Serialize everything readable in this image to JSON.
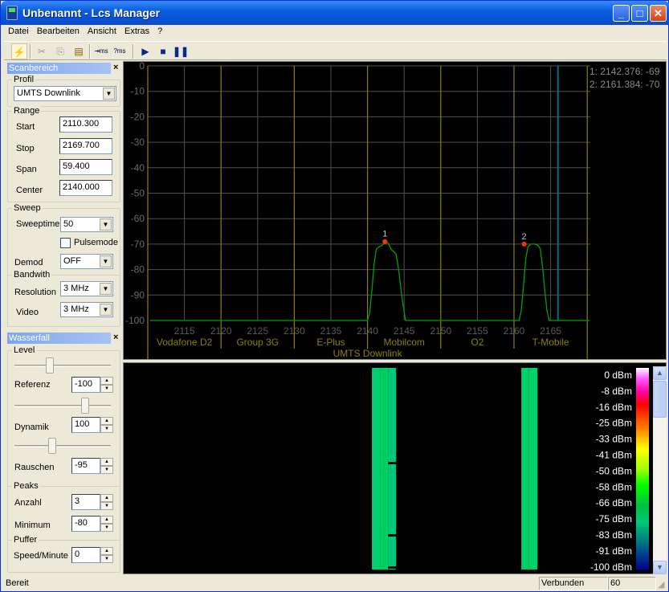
{
  "window": {
    "title": "Unbenannt - Lcs Manager",
    "buttons": [
      "minimize",
      "maximize",
      "close"
    ]
  },
  "menu": [
    "Datei",
    "Bearbeiten",
    "Ansicht",
    "Extras",
    "?"
  ],
  "toolbar": {
    "buttons": [
      {
        "name": "connect-button",
        "icon": "lightning-icon",
        "glyph": "⚡"
      },
      {
        "name": "cut-button",
        "icon": "scissors-icon",
        "glyph": "✂"
      },
      {
        "name": "copy-button",
        "icon": "copy-icon",
        "glyph": "⎘"
      },
      {
        "name": "paste-button",
        "icon": "clipboard-icon",
        "glyph": "📋"
      },
      {
        "name": "sweep-time-button",
        "icon": "sweep-time-icon",
        "glyph": "ms"
      },
      {
        "name": "sweep-time-auto-button",
        "icon": "sweep-time-question-icon",
        "glyph": "?ms"
      },
      {
        "name": "play-button",
        "icon": "play-icon",
        "glyph": "▶"
      },
      {
        "name": "stop-button",
        "icon": "stop-icon",
        "glyph": "■"
      },
      {
        "name": "pause-button",
        "icon": "pause-icon",
        "glyph": "❚❚"
      }
    ]
  },
  "scanbereich": {
    "title": "Scanbereich",
    "close": "×",
    "profil_label": "Profil",
    "profil_value": "UMTS Downlink",
    "range_label": "Range",
    "start_label": "Start",
    "start_value": "2110.300",
    "stop_label": "Stop",
    "stop_value": "2169.700",
    "span_label": "Span",
    "span_value": "59.400",
    "center_label": "Center",
    "center_value": "2140.000",
    "sweep_label": "Sweep",
    "sweeptime_label": "Sweeptime",
    "sweeptime_value": "50",
    "pulsemode_label": "Pulsemode",
    "pulsemode_checked": false,
    "demod_label": "Demod",
    "demod_value": "OFF",
    "bandwith_label": "Bandwith",
    "resolution_label": "Resolution",
    "resolution_value": "3 MHz",
    "video_label": "Video",
    "video_value": "3 MHz"
  },
  "wasserfall": {
    "title": "Wasserfall",
    "close": "×",
    "level_label": "Level",
    "referenz_label": "Referenz",
    "referenz_value": "-100",
    "referenz_slider": 0.35,
    "dynamik_label": "Dynamik",
    "dynamik_value": "100",
    "dynamik_slider": 0.75,
    "rauschen_label": "Rauschen",
    "rauschen_value": "-95",
    "rauschen_slider": 0.38,
    "peaks_label": "Peaks",
    "anzahl_label": "Anzahl",
    "anzahl_value": "3",
    "minimum_label": "Minimum",
    "minimum_value": "-80",
    "puffer_label": "Puffer",
    "speed_label": "Speed/Minute",
    "speed_value": "0"
  },
  "chart_data": {
    "type": "line",
    "title": "",
    "xlabel": "UMTS Downlink",
    "ylabel": "",
    "xlim": [
      2110.3,
      2170.3
    ],
    "ylim": [
      -100,
      0
    ],
    "grid": true,
    "y_ticks": [
      "0",
      "-10",
      "-20",
      "-30",
      "-40",
      "-50",
      "-60",
      "-70",
      "-80",
      "-90",
      "-100"
    ],
    "x_ticks": [
      "2115",
      "2120",
      "2125",
      "2130",
      "2135",
      "2140",
      "2145",
      "2150",
      "2155",
      "2160",
      "2165"
    ],
    "bands": [
      {
        "name": "Vodafone D2",
        "from": 2110,
        "to": 2120
      },
      {
        "name": "Group 3G",
        "from": 2120,
        "to": 2130
      },
      {
        "name": "E-Plus",
        "from": 2130,
        "to": 2140
      },
      {
        "name": "Mobilcom",
        "from": 2140,
        "to": 2150
      },
      {
        "name": "O2",
        "from": 2150,
        "to": 2160
      },
      {
        "name": "T-Mobile",
        "from": 2160,
        "to": 2170
      }
    ],
    "marker_line_freq": 2166.0,
    "series": [
      {
        "name": "Spectrum",
        "color": "#00a000",
        "points": [
          [
            2110.3,
            -100
          ],
          [
            2140.0,
            -100
          ],
          [
            2140.3,
            -97
          ],
          [
            2140.6,
            -88
          ],
          [
            2140.9,
            -78
          ],
          [
            2141.2,
            -72
          ],
          [
            2141.6,
            -71
          ],
          [
            2142.0,
            -70.5
          ],
          [
            2142.4,
            -69
          ],
          [
            2142.8,
            -69.5
          ],
          [
            2143.2,
            -72
          ],
          [
            2143.6,
            -73
          ],
          [
            2143.9,
            -74
          ],
          [
            2144.2,
            -79
          ],
          [
            2144.5,
            -86
          ],
          [
            2144.8,
            -93
          ],
          [
            2145.2,
            -100
          ],
          [
            2160.7,
            -100
          ],
          [
            2161.0,
            -96
          ],
          [
            2161.3,
            -86
          ],
          [
            2161.6,
            -76
          ],
          [
            2161.9,
            -71
          ],
          [
            2162.3,
            -70
          ],
          [
            2162.8,
            -70
          ],
          [
            2163.3,
            -70.5
          ],
          [
            2163.6,
            -72
          ],
          [
            2163.9,
            -79
          ],
          [
            2164.2,
            -88
          ],
          [
            2164.5,
            -96
          ],
          [
            2164.8,
            -100
          ],
          [
            2170.3,
            -100
          ]
        ]
      }
    ],
    "peaks": [
      {
        "label": "1",
        "freq": 2142.376,
        "level": -69
      },
      {
        "label": "2",
        "freq": 2161.384,
        "level": -70
      }
    ],
    "peak_readout": [
      "1: 2142.376: -69",
      "2: 2161.384: -70"
    ]
  },
  "waterfall_data": {
    "legend": [
      "0 dBm",
      "-8 dBm",
      "-16 dBm",
      "-25 dBm",
      "-33 dBm",
      "-41 dBm",
      "-50 dBm",
      "-58 dBm",
      "-66 dBm",
      "-75 dBm",
      "-83 dBm",
      "-91 dBm",
      "-100 dBm"
    ],
    "columns": [
      {
        "from": 2140.6,
        "to": 2141.7,
        "color": "#00cf70"
      },
      {
        "from": 2141.7,
        "to": 2142.8,
        "color": "#00d060"
      },
      {
        "from": 2142.8,
        "to": 2143.9,
        "color": "#00c878"
      },
      {
        "from": 2161.0,
        "to": 2162.0,
        "color": "#00cf68"
      },
      {
        "from": 2162.0,
        "to": 2163.2,
        "color": "#00d26a"
      }
    ]
  },
  "status": {
    "text": "Bereit",
    "connection": "Verbunden",
    "value": "60"
  }
}
